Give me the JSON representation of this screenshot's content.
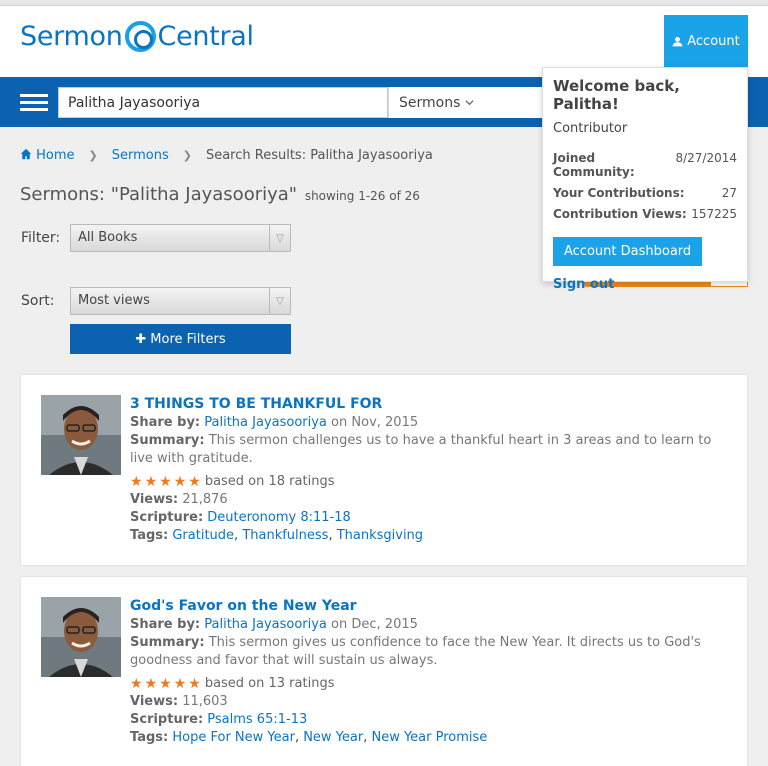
{
  "header": {
    "logo_text_left": "Sermon",
    "logo_text_right": "Central",
    "account_label": "Account"
  },
  "search": {
    "query": "Palitha Jayasooriya",
    "type": "Sermons"
  },
  "breadcrumb": {
    "home": "Home",
    "sermons": "Sermons",
    "current": "Search Results: Palitha Jayasooriya"
  },
  "page": {
    "title": "Sermons: \"Palitha Jayasooriya\"",
    "showing": "showing 1-26 of 26"
  },
  "filters": {
    "filter_label": "Filter:",
    "filter_value": "All Books",
    "sort_label": "Sort:",
    "sort_value": "Most views",
    "more_filters": "More Filters"
  },
  "account_menu": {
    "welcome": "Welcome back, Palitha!",
    "role": "Contributor",
    "joined_label": "Joined Community:",
    "joined_value": "8/27/2014",
    "contrib_label": "Your Contributions:",
    "contrib_value": "27",
    "views_label": "Contribution Views:",
    "views_value": "157225",
    "dashboard_button": "Account Dashboard",
    "signout": "Sign out"
  },
  "labels": {
    "share_by": "Share by:",
    "summary": "Summary:",
    "views": "Views:",
    "scripture": "Scripture:",
    "tags": "Tags:",
    "on": "on"
  },
  "sermons": [
    {
      "title": "3 THINGS TO BE THANKFUL FOR",
      "author": "Palitha Jayasooriya",
      "date": "Nov, 2015",
      "summary": "This sermon challenges us to have a thankful heart in 3 areas and to learn to live with gratitude.",
      "ratings": "based on 18 ratings",
      "rating_stars": 5,
      "views": "21,876",
      "scripture": "Deuteronomy 8:11-18",
      "tags": [
        "Gratitude",
        "Thankfulness",
        "Thanksgiving"
      ]
    },
    {
      "title": "God's Favor on the New Year",
      "author": "Palitha Jayasooriya",
      "date": "Dec, 2015",
      "summary": "This sermon gives us confidence to face the New Year. It directs us to God's goodness and favor that will sustain us always.",
      "ratings": "based on 13 ratings",
      "rating_stars": 5,
      "views": "11,603",
      "scripture": "Psalms 65:1-13",
      "tags": [
        "Hope For New Year",
        "New Year",
        "New Year Promise"
      ]
    }
  ],
  "colors": {
    "brand_blue": "#0a62b0",
    "accent_blue": "#1aa3e8",
    "link_blue": "#0a74c4",
    "star_orange": "#f07a1a",
    "orange_button": "#ee8a1c"
  }
}
